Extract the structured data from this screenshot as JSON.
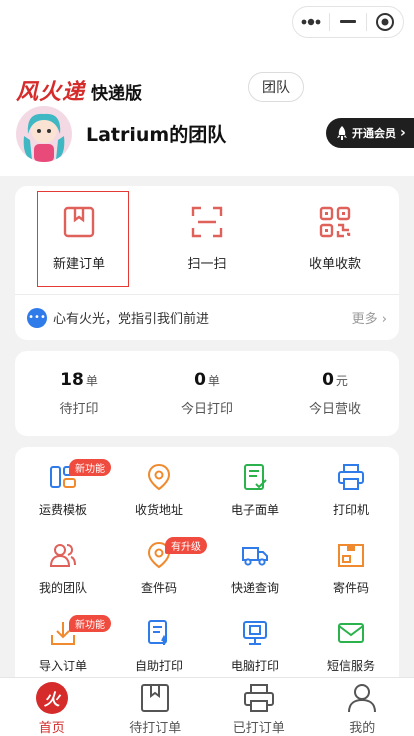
{
  "header": {
    "capsule": {
      "more_icon": "dots-icon",
      "minimize_icon": "minus-icon",
      "close_icon": "target-circle-icon"
    },
    "brand_logo": "风火递",
    "brand_sub": "快递版",
    "team_button": "团队",
    "team_name": "Latrium的团队",
    "vip_button": "开通会员"
  },
  "quick_actions": [
    {
      "label": "新建订单",
      "icon": "new-order-icon"
    },
    {
      "label": "扫一扫",
      "icon": "scan-icon"
    },
    {
      "label": "收单收款",
      "icon": "qr-code-icon"
    }
  ],
  "notice": {
    "text": "心有火光，党指引我们前进",
    "more": "更多"
  },
  "stats": [
    {
      "value": "18",
      "unit": "单",
      "label": "待打印"
    },
    {
      "value": "0",
      "unit": "单",
      "label": "今日打印"
    },
    {
      "value": "0",
      "unit": "元",
      "label": "今日营收"
    }
  ],
  "tools": [
    {
      "label": "运费模板",
      "icon": "template-icon",
      "badge": "新功能"
    },
    {
      "label": "收货地址",
      "icon": "location-icon",
      "badge": ""
    },
    {
      "label": "电子面单",
      "icon": "e-waybill-icon",
      "badge": ""
    },
    {
      "label": "打印机",
      "icon": "printer-icon",
      "badge": ""
    },
    {
      "label": "我的团队",
      "icon": "team-icon",
      "badge": ""
    },
    {
      "label": "查件码",
      "icon": "query-code-icon",
      "badge": "有升级"
    },
    {
      "label": "快递查询",
      "icon": "truck-icon",
      "badge": ""
    },
    {
      "label": "寄件码",
      "icon": "store-icon",
      "badge": ""
    },
    {
      "label": "导入订单",
      "icon": "import-icon",
      "badge": "新功能"
    },
    {
      "label": "自助打印",
      "icon": "self-print-icon",
      "badge": ""
    },
    {
      "label": "电脑打印",
      "icon": "pc-print-icon",
      "badge": ""
    },
    {
      "label": "短信服务",
      "icon": "sms-icon",
      "badge": ""
    }
  ],
  "tabs": [
    {
      "label": "首页",
      "icon": "home-fire-icon",
      "active": true
    },
    {
      "label": "待打订单",
      "icon": "pending-box-icon",
      "active": false
    },
    {
      "label": "已打订单",
      "icon": "printed-icon",
      "active": false
    },
    {
      "label": "我的",
      "icon": "user-icon",
      "active": false
    }
  ],
  "colors": {
    "accent": "#d52b2b",
    "blue": "#2f7bea",
    "orange": "#f08a2e",
    "green": "#2bb24c"
  }
}
